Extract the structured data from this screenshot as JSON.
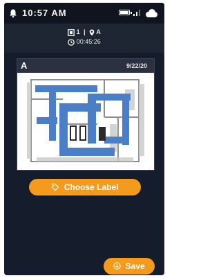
{
  "status_bar": {
    "time": "10:57 AM",
    "icons": [
      "bell-icon",
      "battery-icon",
      "signal-icon",
      "cloud-icon"
    ]
  },
  "header": {
    "floor": "1",
    "separator": "|",
    "location": "A",
    "duration": "00:45:26"
  },
  "map_card": {
    "label": "A",
    "date": "9/22/20"
  },
  "buttons": {
    "choose_label": "Choose Label",
    "save": "Save"
  },
  "colors": {
    "accent": "#f49a1c",
    "background": "#151d2c",
    "path": "#4a7fc8"
  }
}
